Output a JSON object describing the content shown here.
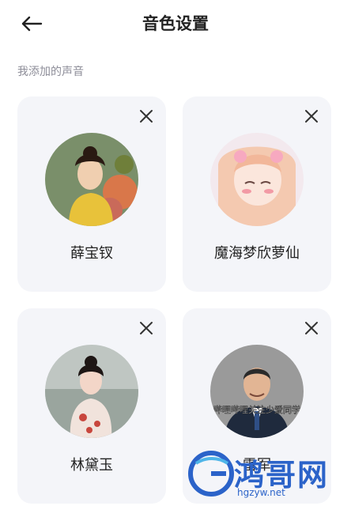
{
  "header": {
    "title": "音色设置",
    "back_icon": "arrow-left-icon"
  },
  "section": {
    "label": "我添加的声音"
  },
  "voices": [
    {
      "name": "薛宝钗"
    },
    {
      "name": "魔海梦欣萝仙"
    },
    {
      "name": "林黛玉"
    },
    {
      "name": "雷军",
      "avatar_caption": "哔哩哔哩关注少爱同学"
    }
  ],
  "watermark": {
    "text": "鸿哥网",
    "url": "hgzyw.net"
  },
  "colors": {
    "card_bg": "#f4f5f9",
    "watermark": "#2b63c9"
  }
}
